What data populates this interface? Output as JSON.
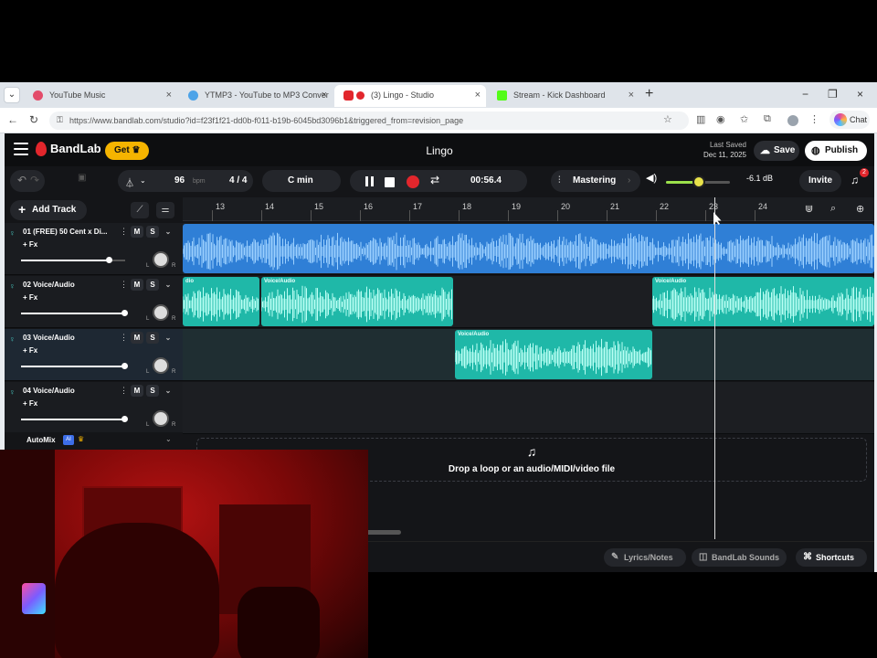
{
  "browser": {
    "tabs": [
      {
        "title": "YouTube Music",
        "favicon_color": "#e34c6a",
        "active": false
      },
      {
        "title": "YTMP3 - YouTube to MP3 Conver",
        "favicon_color": "#4da3e8",
        "active": false
      },
      {
        "title": "(3) Lingo - Studio",
        "favicon_color": "#e2262c",
        "active": true
      },
      {
        "title": "Stream - Kick Dashboard",
        "favicon_color": "#53fc18",
        "active": false
      }
    ],
    "url": "https://www.bandlab.com/studio?id=f23f1f21-dd0b-f011-b19b-6045bd3096b1&triggered_from=revision_page",
    "chat_label": "Chat"
  },
  "app": {
    "brand": "BandLab",
    "get_label": "Get",
    "project_title": "Lingo",
    "last_saved_label": "Last Saved",
    "last_saved_date": "Dec 11, 2025",
    "save_label": "Save",
    "publish_label": "Publish",
    "bpm": "96",
    "bpm_unit": "bpm",
    "time_signature": "4 / 4",
    "key": "C min",
    "time": "00:56.4",
    "mastering_label": "Mastering",
    "master_volume": 0.52,
    "master_db": "-6.1 dB",
    "invite_label": "Invite",
    "notification_count": "2",
    "add_track_label": "Add Track",
    "ruler_marks": [
      "13",
      "14",
      "15",
      "16",
      "17",
      "18",
      "19",
      "20",
      "21",
      "22",
      "23",
      "24"
    ],
    "tracks": [
      {
        "name": "01  (FREE) 50 Cent x Di...",
        "fx": "+ Fx",
        "mute": "M",
        "solo": "S",
        "volume": 0.85,
        "color": "#3a8de8"
      },
      {
        "name": "02  Voice/Audio",
        "fx": "+ Fx",
        "mute": "M",
        "solo": "S",
        "volume": 1.0,
        "color": "#2fd3c3"
      },
      {
        "name": "03  Voice/Audio",
        "fx": "+ Fx",
        "mute": "M",
        "solo": "S",
        "volume": 1.0,
        "color": "#2fd3c3"
      },
      {
        "name": "04  Voice/Audio",
        "fx": "+ Fx",
        "mute": "M",
        "solo": "S",
        "volume": 1.0,
        "color": "#2fd3c3"
      }
    ],
    "clips": {
      "track2": [
        "dio",
        "Voice/Audio",
        "Voice/Audio"
      ],
      "track3": [
        "Voice/Audio"
      ]
    },
    "pan_left": "L",
    "pan_right": "R",
    "automix_label": "AutoMix",
    "ai_badge": "AI",
    "drop_text": "Drop a loop or an audio/MIDI/video file",
    "bottom": {
      "lyrics_label": "Lyrics/Notes",
      "sounds_label": "BandLab Sounds",
      "shortcuts_label": "Shortcuts"
    }
  },
  "icons": {
    "tab_close": "×",
    "new_tab": "+",
    "minimize": "−",
    "maximize": "❐",
    "close": "×",
    "back": "←",
    "refresh": "↻",
    "undo": "↶",
    "redo": "↷",
    "more": "⋮",
    "chevron": "⌄",
    "music_note": "♫"
  }
}
